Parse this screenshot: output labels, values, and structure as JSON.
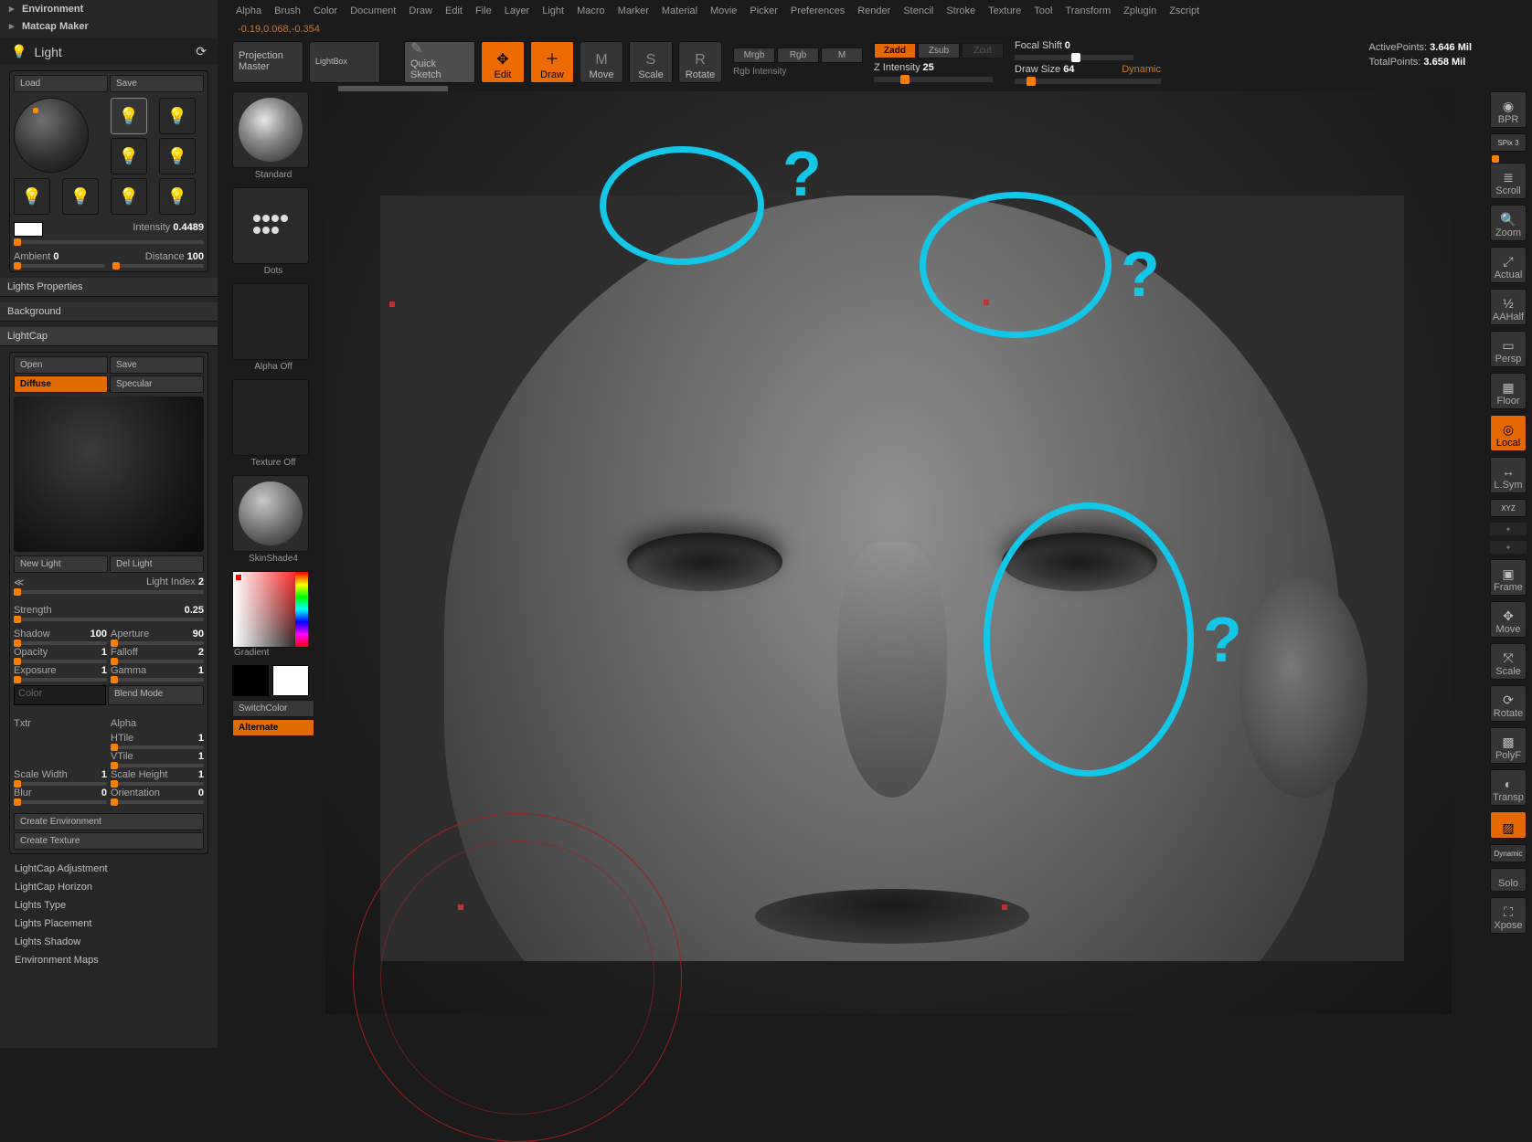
{
  "left_tree": {
    "item0": "Environment",
    "item1": "Matcap Maker",
    "palette": "Light"
  },
  "menu": [
    "Alpha",
    "Brush",
    "Color",
    "Document",
    "Draw",
    "Edit",
    "File",
    "Layer",
    "Light",
    "Macro",
    "Marker",
    "Material",
    "Movie",
    "Picker",
    "Preferences",
    "Render",
    "Stencil",
    "Stroke",
    "Texture",
    "Tool",
    "Transform",
    "Zplugin",
    "Zscript"
  ],
  "coords": "-0.19,0.068,-0.354",
  "toolbar": {
    "projection": "Projection\nMaster",
    "lightbox": "LightBox",
    "quicksketch": "Quick\nSketch",
    "edit": "Edit",
    "draw": "Draw",
    "move": "Move",
    "scale": "Scale",
    "rotate": "Rotate"
  },
  "top_opts": {
    "mrgb": "Mrgb",
    "rgb": "Rgb",
    "m": "M",
    "rgb_int_lbl": "Rgb Intensity",
    "zadd": "Zadd",
    "zsub": "Zsub",
    "zcut": "Zcut",
    "z_int_lbl": "Z Intensity",
    "z_int_val": "25",
    "focal_lbl": "Focal Shift",
    "focal_val": "0",
    "draw_lbl": "Draw Size",
    "draw_val": "64",
    "dynamic": "Dynamic"
  },
  "stats": {
    "active_lbl": "ActivePoints:",
    "active_val": "3.646 Mil",
    "total_lbl": "TotalPoints:",
    "total_val": "3.658 Mil"
  },
  "brush": {
    "standard": "Standard",
    "dots": "Dots",
    "alpha": "Alpha Off",
    "tex": "Texture Off",
    "mat": "SkinShade4",
    "gradient": "Gradient",
    "switch": "SwitchColor",
    "alt": "Alternate"
  },
  "light_panel": {
    "load": "Load",
    "save": "Save",
    "int_lbl": "Intensity",
    "int_val": "0.4489",
    "amb_lbl": "Ambient",
    "amb_val": "0",
    "dist_lbl": "Distance",
    "dist_val": "100",
    "props": "Lights Properties",
    "bg": "Background"
  },
  "lightcap": {
    "hdr": "LightCap",
    "open": "Open",
    "save": "Save",
    "diff": "Diffuse",
    "spec": "Specular",
    "new": "New Light",
    "del": "Del Light",
    "idx_lbl": "Light Index",
    "idx_val": "2",
    "str_lbl": "Strength",
    "str_val": "0.25",
    "shadow_lbl": "Shadow",
    "shadow_val": "100",
    "ap_lbl": "Aperture",
    "ap_val": "90",
    "opa_lbl": "Opacity",
    "opa_val": "1",
    "fo_lbl": "Falloff",
    "fo_val": "2",
    "exp_lbl": "Exposure",
    "exp_val": "1",
    "gam_lbl": "Gamma",
    "gam_val": "1",
    "color": "Color",
    "blend": "Blend Mode",
    "txtr": "Txtr",
    "alpha": "Alpha",
    "ht_lbl": "HTile",
    "ht_val": "1",
    "vt_lbl": "VTile",
    "vt_val": "1",
    "sw_lbl": "Scale Width",
    "sw_val": "1",
    "sh_lbl": "Scale Height",
    "sh_val": "1",
    "blur_lbl": "Blur",
    "blur_val": "0",
    "ori_lbl": "Orientation",
    "ori_val": "0",
    "env": "Create Environment",
    "tex": "Create Texture"
  },
  "tree2": [
    "LightCap Adjustment",
    "LightCap Horizon",
    "Lights Type",
    "Lights Placement",
    "Lights Shadow",
    "Environment Maps"
  ],
  "right": {
    "bpr": "BPR",
    "spix": "SPix 3",
    "scroll": "Scroll",
    "zoom": "Zoom",
    "actual": "Actual",
    "aahalf": "AAHalf",
    "persp": "Persp",
    "floor": "Floor",
    "local": "Local",
    "lsym": "L.Sym",
    "xyz": "XYZ",
    "frame": "Frame",
    "move": "Move",
    "scale": "Scale",
    "rotate": "Rotate",
    "polyf": "PolyF",
    "transp": "Transp",
    "ghost": "Ghost",
    "dynsolo": "Dynamic",
    "solo": "Solo",
    "xpose": "Xpose"
  }
}
